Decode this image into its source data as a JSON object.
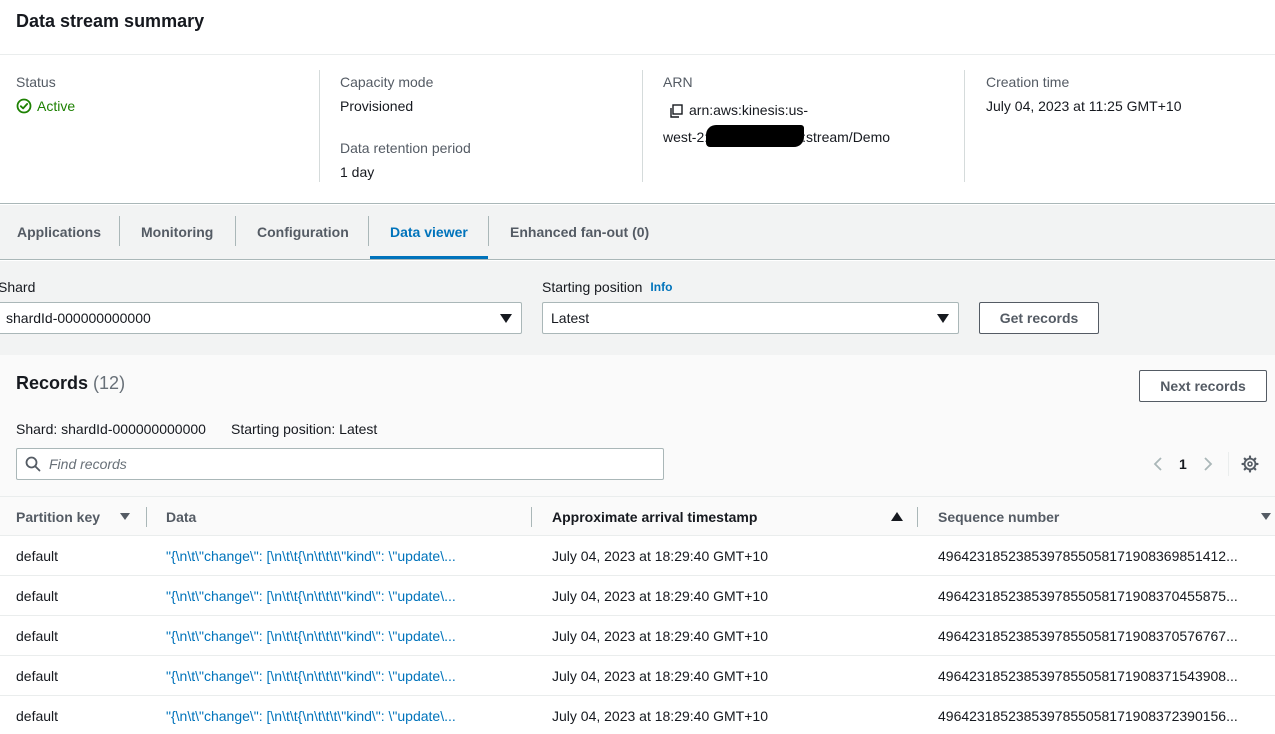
{
  "summary": {
    "title": "Data stream summary",
    "status_label": "Status",
    "status_value": "Active",
    "capacity_label": "Capacity mode",
    "capacity_value": "Provisioned",
    "retention_label": "Data retention period",
    "retention_value": "1 day",
    "arn_label": "ARN",
    "arn_line1": "arn:aws:kinesis:us-",
    "arn_line2_start": "west-2:",
    "arn_line2_end": ":stream/Demo",
    "creation_label": "Creation time",
    "creation_value": "July 04, 2023 at 11:25 GMT+10"
  },
  "tabs": [
    {
      "label": "Applications"
    },
    {
      "label": "Monitoring"
    },
    {
      "label": "Configuration"
    },
    {
      "label": "Data viewer"
    },
    {
      "label": "Enhanced fan-out (0)"
    }
  ],
  "filters": {
    "shard_label": "Shard",
    "shard_value": "shardId-000000000000",
    "position_label": "Starting position",
    "info_link": "Info",
    "position_value": "Latest",
    "get_records_label": "Get records"
  },
  "records": {
    "title": "Records",
    "count": "(12)",
    "next_label": "Next records",
    "shard_meta": "Shard: shardId-000000000000",
    "position_meta": "Starting position: Latest",
    "search_placeholder": "Find records",
    "page": "1"
  },
  "table": {
    "columns": [
      {
        "label": "Partition key"
      },
      {
        "label": "Data"
      },
      {
        "label": "Approximate arrival timestamp"
      },
      {
        "label": "Sequence number"
      }
    ],
    "rows": [
      {
        "partition_key": "default",
        "data": "\"{\\n\\t\\\"change\\\": [\\n\\t\\t{\\n\\t\\t\\t\\\"kind\\\": \\\"update\\...",
        "timestamp": "July 04, 2023 at 18:29:40 GMT+10",
        "sequence": "4964231852385397855058171908369851412..."
      },
      {
        "partition_key": "default",
        "data": "\"{\\n\\t\\\"change\\\": [\\n\\t\\t{\\n\\t\\t\\t\\\"kind\\\": \\\"update\\...",
        "timestamp": "July 04, 2023 at 18:29:40 GMT+10",
        "sequence": "4964231852385397855058171908370455875..."
      },
      {
        "partition_key": "default",
        "data": "\"{\\n\\t\\\"change\\\": [\\n\\t\\t{\\n\\t\\t\\t\\\"kind\\\": \\\"update\\...",
        "timestamp": "July 04, 2023 at 18:29:40 GMT+10",
        "sequence": "4964231852385397855058171908370576767..."
      },
      {
        "partition_key": "default",
        "data": "\"{\\n\\t\\\"change\\\": [\\n\\t\\t{\\n\\t\\t\\t\\\"kind\\\": \\\"update\\...",
        "timestamp": "July 04, 2023 at 18:29:40 GMT+10",
        "sequence": "4964231852385397855058171908371543908..."
      },
      {
        "partition_key": "default",
        "data": "\"{\\n\\t\\\"change\\\": [\\n\\t\\t{\\n\\t\\t\\t\\\"kind\\\": \\\"update\\...",
        "timestamp": "July 04, 2023 at 18:29:40 GMT+10",
        "sequence": "4964231852385397855058171908372390156..."
      }
    ]
  },
  "colors": {
    "accent": "#0073bb",
    "success": "#1d8102",
    "text": "#16191f",
    "muted": "#545b64"
  }
}
